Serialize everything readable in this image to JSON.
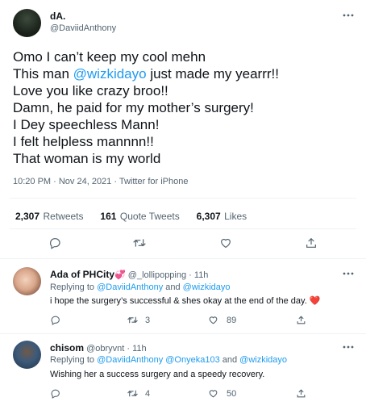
{
  "main": {
    "author_name": "dA.",
    "author_handle": "@DaviidAnthony",
    "lines": [
      {
        "pre": "Omo I can’t keep my cool mehn",
        "mention": "",
        "post": ""
      },
      {
        "pre": "This man ",
        "mention": "@wizkidayo",
        "post": " just made my yearrr!!"
      },
      {
        "pre": "Love you like crazy broo!!",
        "mention": "",
        "post": ""
      },
      {
        "pre": "Damn, he paid for my mother’s surgery!",
        "mention": "",
        "post": ""
      },
      {
        "pre": "I Dey speechless Mann!",
        "mention": "",
        "post": ""
      },
      {
        "pre": "I felt helpless mannnn!!",
        "mention": "",
        "post": ""
      },
      {
        "pre": "That woman is my world",
        "mention": "",
        "post": ""
      }
    ],
    "timestamp": "10:20 PM · Nov 24, 2021 · Twitter for iPhone",
    "stats": {
      "retweets_count": "2,307",
      "retweets_label": "Retweets",
      "quotes_count": "161",
      "quotes_label": "Quote Tweets",
      "likes_count": "6,307",
      "likes_label": "Likes"
    }
  },
  "replies": [
    {
      "name": "Ada of PHCity",
      "emoji": "💞",
      "handle": "@_lollipopping",
      "time": "· 11h",
      "replying_prefix": "Replying to ",
      "replying_to_1": "@DaviidAnthony",
      "replying_to_2": "",
      "replying_and": " and ",
      "replying_to_3": "@wizkidayo",
      "text": "i hope the surgery’s successful & shes okay at the end of the day.",
      "text_emoji": "❤️",
      "retweets": "3",
      "likes": "89"
    },
    {
      "name": "chisom",
      "emoji": "",
      "handle": "@obryvnt",
      "time": "· 11h",
      "replying_prefix": "Replying to ",
      "replying_to_1": "@DaviidAnthony",
      "replying_to_2": "@Onyeka103",
      "replying_and": " and ",
      "replying_to_3": "@wizkidayo",
      "text": "Wishing her a success surgery and a speedy recovery.",
      "text_emoji": "",
      "retweets": "4",
      "likes": "50"
    }
  ],
  "icons": {
    "more": "more-horizontal-icon",
    "reply": "reply-bubble-icon",
    "retweet": "retweet-icon",
    "like": "heart-outline-icon",
    "share": "share-upload-icon"
  },
  "colors": {
    "accent": "#1d9bf0",
    "text": "#0f1419",
    "muted": "#536471",
    "divider": "#eff3f4",
    "heart": "#e0245e"
  }
}
